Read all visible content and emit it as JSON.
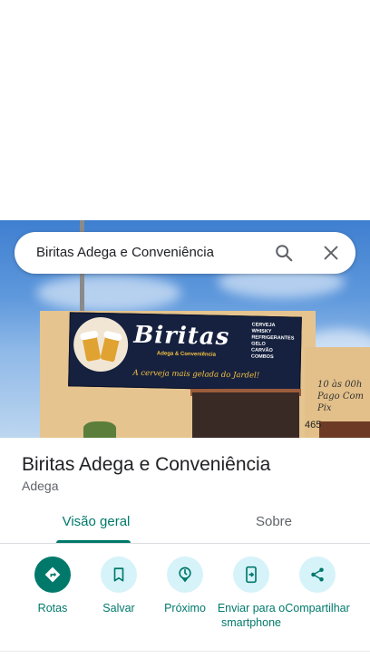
{
  "search": {
    "value": "Biritas Adega e Conveniência"
  },
  "photo": {
    "sign_brand": "Biritas",
    "sign_subtitle": "Adega & Conveniência",
    "sign_products": [
      "CERVEJA",
      "WHISKY",
      "REFRIGERANTES",
      "GELO",
      "CARVÃO",
      "COMBOS"
    ],
    "sign_tagline": "A cerveja mais gelada do Jardel!",
    "side_text": [
      "10 às 00h",
      "Pago Com",
      "Pix"
    ],
    "address_number": "465"
  },
  "place": {
    "title": "Biritas Adega e Conveniência",
    "category": "Adega"
  },
  "tabs": [
    {
      "label": "Visão geral",
      "active": true
    },
    {
      "label": "Sobre",
      "active": false
    }
  ],
  "actions": [
    {
      "label": "Rotas",
      "icon": "directions-icon"
    },
    {
      "label": "Salvar",
      "icon": "bookmark-icon"
    },
    {
      "label": "Próximo",
      "icon": "nearby-icon"
    },
    {
      "label": "Enviar para o smartphone",
      "icon": "send-to-phone-icon"
    },
    {
      "label": "Compartilhar",
      "icon": "share-icon"
    }
  ],
  "colors": {
    "accent": "#00796b",
    "action_bg": "#d6f3f9"
  }
}
